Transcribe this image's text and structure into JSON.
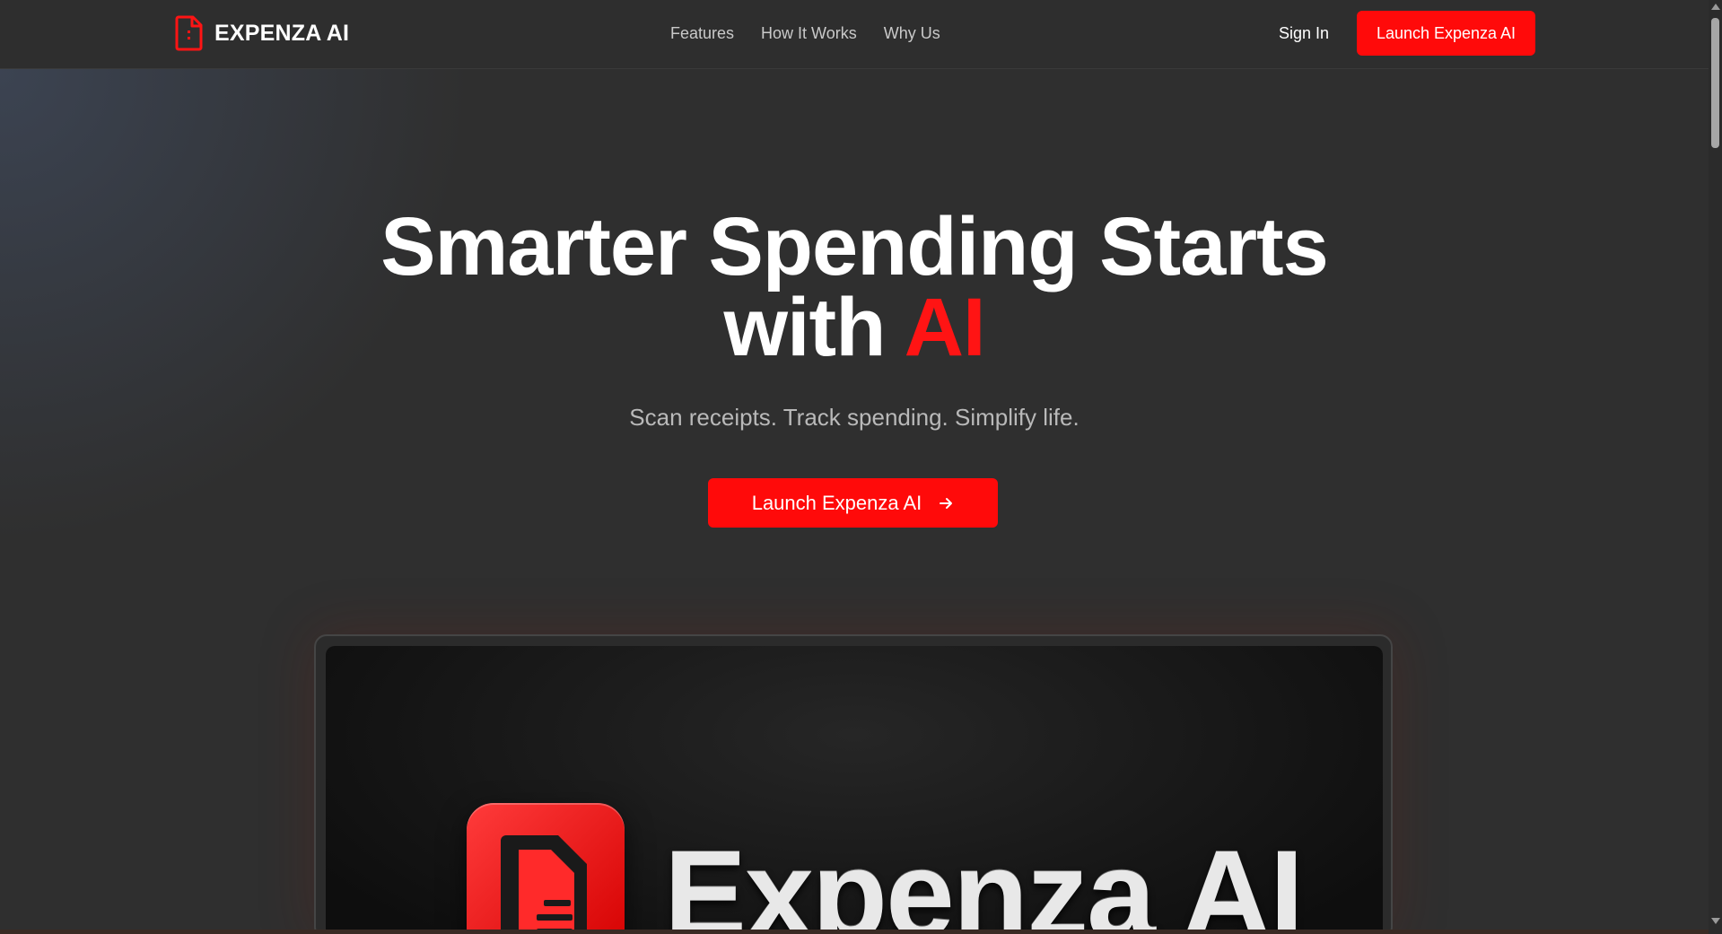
{
  "brand": {
    "name": "EXPENZA AI",
    "accent_color": "#ff0a0a"
  },
  "nav": {
    "links": [
      "Features",
      "How It Works",
      "Why Us"
    ],
    "signin_label": "Sign In",
    "cta_label": "Launch Expenza AI"
  },
  "hero": {
    "title_line1": "Smarter Spending Starts",
    "title_line2_prefix": "with",
    "title_line2_accent": "AI",
    "subtitle": "Scan receipts. Track spending. Simplify life.",
    "cta_label": "Launch Expenza AI"
  },
  "preview": {
    "brand_text": "Expenza AI"
  },
  "icons": {
    "brand": "receipt-file-icon",
    "cta_arrow": "arrow-right-icon"
  }
}
